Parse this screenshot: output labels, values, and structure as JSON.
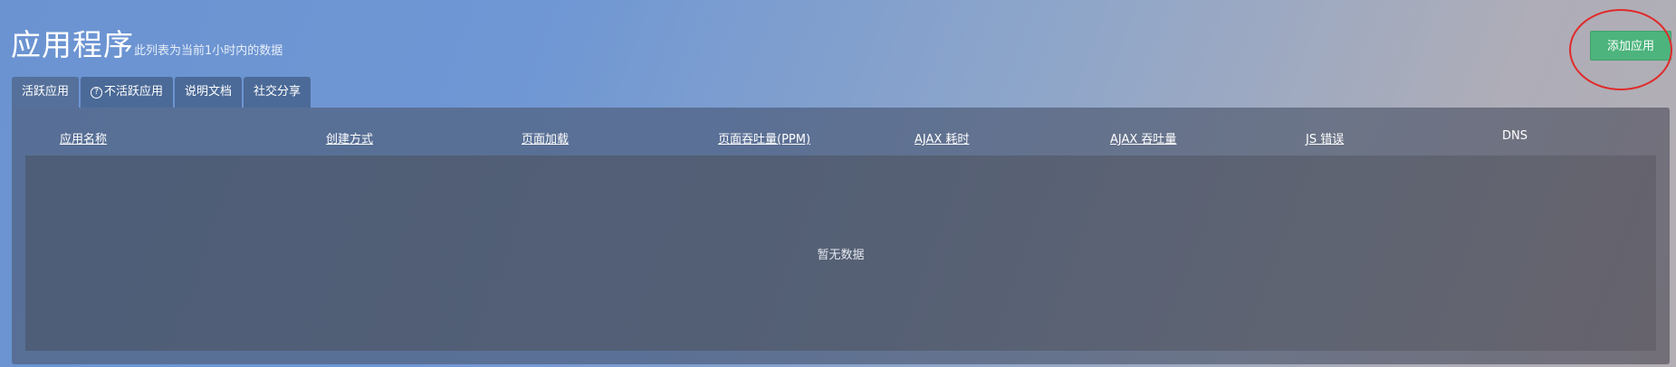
{
  "header": {
    "title": "应用程序",
    "subtitle": "此列表为当前1小时内的数据",
    "add_button_label": "添加应用"
  },
  "tabs": [
    {
      "label": "活跃应用",
      "active": true
    },
    {
      "label": "不活跃应用",
      "icon": "help-circle-icon",
      "icon_glyph": "?",
      "active": false
    },
    {
      "label": "说明文档",
      "active": false
    },
    {
      "label": "社交分享",
      "active": false
    }
  ],
  "table": {
    "columns": [
      "应用名称",
      "创建方式",
      "页面加载",
      "页面吞吐量(PPM)",
      "AJAX 耗时",
      "AJAX 吞吐量",
      "JS 错误",
      "DNS"
    ],
    "rows": [],
    "empty_text": "暂无数据"
  },
  "colors": {
    "accent_button": "#4cb47c",
    "highlight_ring": "#e02a2a"
  }
}
